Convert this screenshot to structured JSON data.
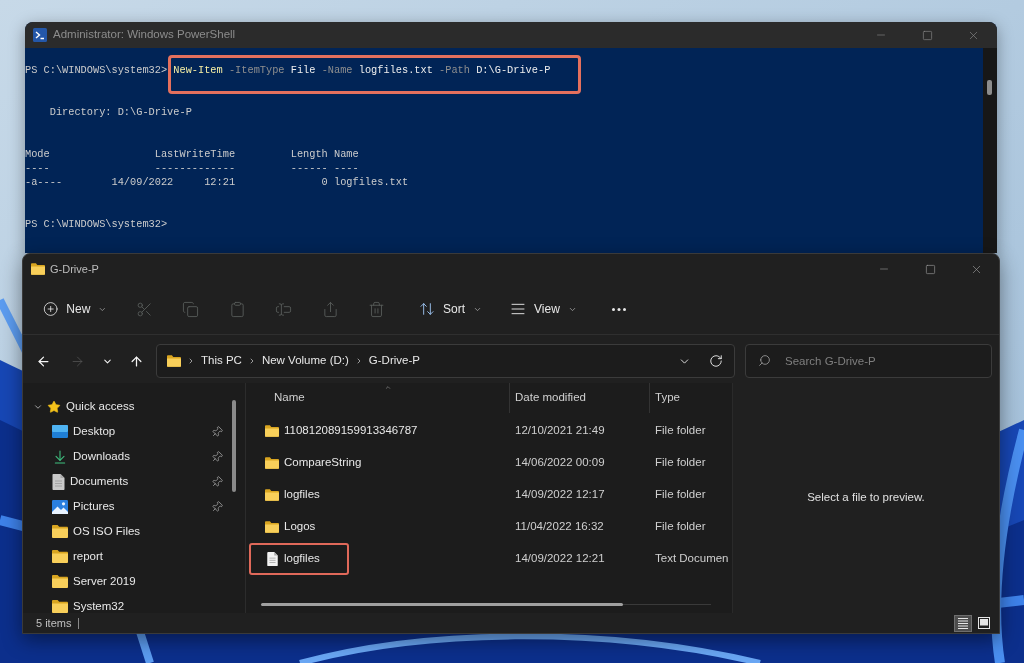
{
  "powershell": {
    "title": "Administrator: Windows PowerShell",
    "blocks": [
      {
        "lines": [
          {
            "kind": "input",
            "prompt": "PS C:\\WINDOWS\\system32>",
            "tokens": [
              {
                "text": "New-Item",
                "kind": "command"
              },
              {
                "text": "-ItemType",
                "kind": "parameter"
              },
              {
                "text": "File",
                "kind": "argument"
              },
              {
                "text": "-Name",
                "kind": "parameter"
              },
              {
                "text": "logfiles.txt",
                "kind": "argument"
              },
              {
                "text": "-Path",
                "kind": "parameter"
              },
              {
                "text": "D:\\G-Drive-P",
                "kind": "argument"
              }
            ],
            "highlighted": true
          }
        ]
      },
      {
        "lines": [
          {
            "kind": "heading",
            "text": "Directory: D:\\G-Drive-P"
          }
        ]
      },
      {
        "lines": [
          {
            "kind": "output",
            "text": "Mode                 LastWriteTime         Length Name"
          },
          {
            "kind": "output",
            "text": "----                 -------------         ------ ----"
          },
          {
            "kind": "output",
            "text": "-a----        14/09/2022     12:21              0 logfiles.txt"
          }
        ]
      },
      {
        "lines": [
          {
            "kind": "input",
            "prompt": "PS C:\\WINDOWS\\system32>",
            "highlighted": false
          }
        ]
      }
    ]
  },
  "explorer": {
    "title": "G-Drive-P",
    "toolbar": {
      "new": {
        "label": "New"
      },
      "actions": [
        {
          "disabled": true
        },
        {
          "disabled": true
        },
        {
          "disabled": true
        },
        {
          "disabled": true
        },
        {
          "disabled": true
        },
        {
          "disabled": true
        }
      ],
      "sort": {
        "label": "Sort"
      },
      "view": {
        "label": "View"
      }
    },
    "nav_buttons": [
      {
        "disabled": false
      },
      {
        "disabled": true
      },
      {
        "disabled": false
      },
      {
        "disabled": false
      }
    ],
    "address_bar": {
      "path": [
        "This PC",
        "New Volume (D:)",
        "G-Drive-P"
      ]
    },
    "search": {
      "placeholder": "Search G-Drive-P"
    },
    "sidebar": {
      "items": [
        {
          "label": "Quick access",
          "kind": "starred",
          "expanded": true,
          "children": [
            {
              "label": "Desktop",
              "kind": "desktop",
              "pinned": true
            },
            {
              "label": "Downloads",
              "kind": "download",
              "pinned": true
            },
            {
              "label": "Documents",
              "kind": "document",
              "pinned": true
            },
            {
              "label": "Pictures",
              "kind": "picture",
              "pinned": true
            },
            {
              "label": "OS ISO Files",
              "kind": "folder",
              "pinned": false
            },
            {
              "label": "report",
              "kind": "folder",
              "pinned": false
            },
            {
              "label": "Server 2019",
              "kind": "folder",
              "pinned": false
            },
            {
              "label": "System32",
              "kind": "folder",
              "pinned": false
            }
          ]
        }
      ]
    },
    "files": {
      "columns": [
        {
          "label": "Name",
          "sorted": true
        },
        {
          "label": "Date modified",
          "sorted": false
        },
        {
          "label": "Type",
          "sorted": false
        }
      ],
      "rows": [
        {
          "name": "110812089159913346787",
          "date": "12/10/2021 21:49",
          "type": "File folder",
          "kind": "folder",
          "highlighted": false
        },
        {
          "name": "CompareString",
          "date": "14/06/2022 00:09",
          "type": "File folder",
          "kind": "folder",
          "highlighted": false
        },
        {
          "name": "logfiles",
          "date": "14/09/2022 12:17",
          "type": "File folder",
          "kind": "folder",
          "highlighted": false
        },
        {
          "name": "Logos",
          "date": "11/04/2022 16:32",
          "type": "File folder",
          "kind": "folder",
          "highlighted": false
        },
        {
          "name": "logfiles",
          "date": "14/09/2022 12:21",
          "type": "Text Documen",
          "kind": "text",
          "highlighted": true
        }
      ]
    },
    "preview": {
      "message": "Select a file to preview."
    },
    "status_bar": {
      "count": "5 items",
      "views": [
        {
          "selected": true
        },
        {
          "selected": false
        }
      ]
    }
  }
}
